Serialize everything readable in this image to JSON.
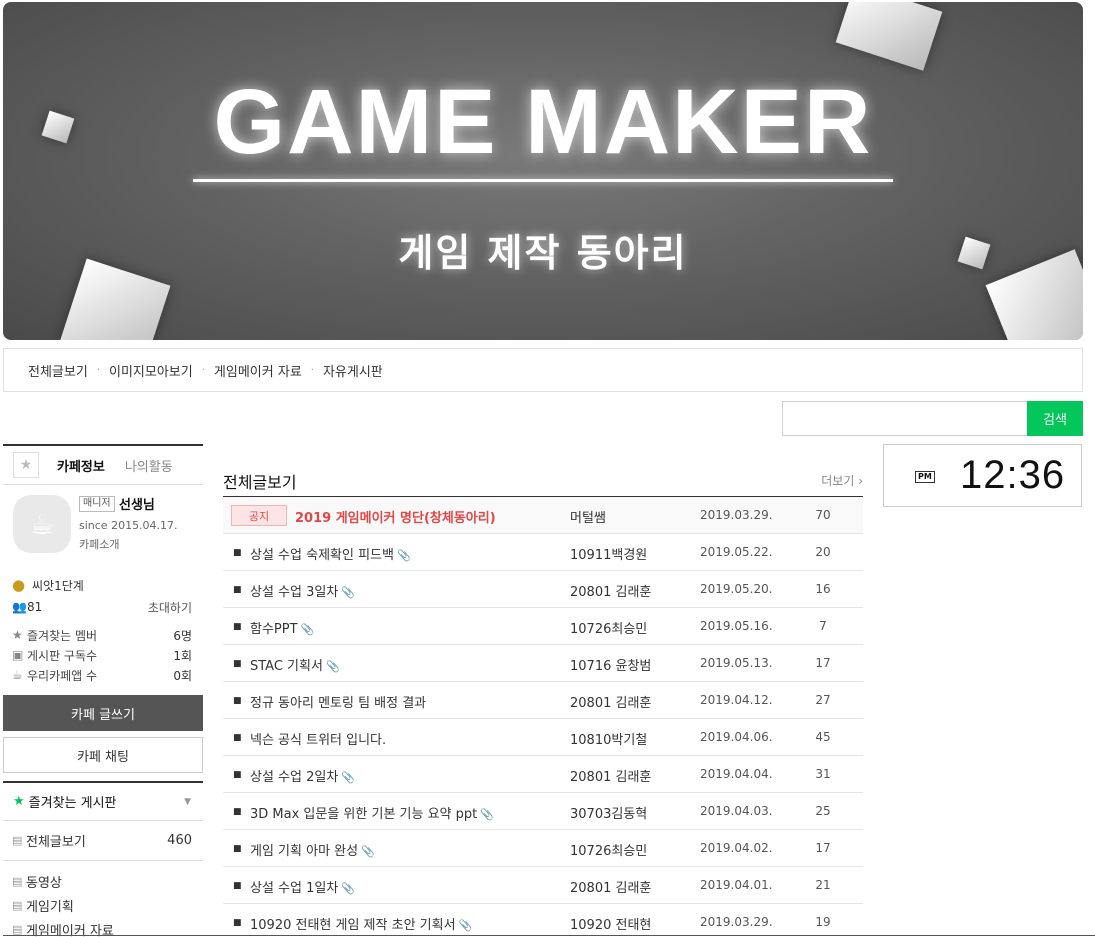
{
  "banner": {
    "title": "GAME MAKER",
    "subtitle": "게임 제작 동아리"
  },
  "menu": {
    "items": [
      "전체글보기",
      "이미지모아보기",
      "게임메이커 자료",
      "자유게시판"
    ],
    "separator": "·"
  },
  "search": {
    "value": "",
    "button_label": "검색"
  },
  "sidebar": {
    "tab_cafe_info": "카페정보",
    "tab_my_activity": "나의활동",
    "manager_badge": "매니저",
    "manager_name": "선생님",
    "since": "since 2015.04.17.",
    "cafe_intro": "카페소개",
    "level": "씨앗1단계",
    "member_count": "81",
    "invite": "초대하기",
    "stats": [
      {
        "label": "즐겨찾는 멤버",
        "value": "6명"
      },
      {
        "label": "게시판 구독수",
        "value": "1회"
      },
      {
        "label": "우리카페앱 수",
        "value": "0회"
      }
    ],
    "write_button": "카페 글쓰기",
    "chat_button": "카페 채팅",
    "favorites_title": "즐겨찾는 게시판",
    "all_posts": {
      "label": "전체글보기",
      "count": "460"
    },
    "boards": [
      "동영상",
      "게임기획",
      "게임메이커 자료"
    ]
  },
  "main": {
    "title": "전체글보기",
    "more": "더보기 ›",
    "notice": {
      "badge": "공지",
      "title": "2019 게임메이커 명단(창체동아리)",
      "author": "머털쌤",
      "date": "2019.03.29.",
      "views": "70"
    },
    "posts": [
      {
        "title": "상설 수업 숙제확인 피드백",
        "clip": true,
        "author": "10911백경원",
        "date": "2019.05.22.",
        "views": "20"
      },
      {
        "title": "상설 수업 3일차",
        "clip": true,
        "author": "20801 김래훈",
        "date": "2019.05.20.",
        "views": "16"
      },
      {
        "title": "함수PPT",
        "clip": true,
        "author": "10726최승민",
        "date": "2019.05.16.",
        "views": "7"
      },
      {
        "title": "STAC 기획서",
        "clip": true,
        "author": "10716 윤창범",
        "date": "2019.05.13.",
        "views": "17"
      },
      {
        "title": "정규 동아리 멘토링 팀 배정 결과",
        "clip": false,
        "author": "20801 김래훈",
        "date": "2019.04.12.",
        "views": "27"
      },
      {
        "title": "넥슨 공식 트위터 입니다.",
        "clip": false,
        "author": "10810박기철",
        "date": "2019.04.06.",
        "views": "45"
      },
      {
        "title": "상설 수업 2일차",
        "clip": true,
        "author": "20801 김래훈",
        "date": "2019.04.04.",
        "views": "31"
      },
      {
        "title": "3D Max 입문을 위한 기본 기능 요약 ppt",
        "clip": true,
        "author": "30703김동혁",
        "date": "2019.04.03.",
        "views": "25"
      },
      {
        "title": "게임 기획 아마 완성",
        "clip": true,
        "author": "10726최승민",
        "date": "2019.04.02.",
        "views": "17"
      },
      {
        "title": "상설 수업 1일차",
        "clip": true,
        "author": "20801 김래훈",
        "date": "2019.04.01.",
        "views": "21"
      },
      {
        "title": "10920 전태현 게임 제작 초안 기획서",
        "clip": true,
        "author": "10920 전태현",
        "date": "2019.03.29.",
        "views": "19"
      }
    ]
  },
  "clock": {
    "ampm": "PM",
    "time": "12:36"
  },
  "colors": {
    "accent_green": "#03c75a",
    "notice_red": "#e04848",
    "write_button_bg": "#555555"
  }
}
